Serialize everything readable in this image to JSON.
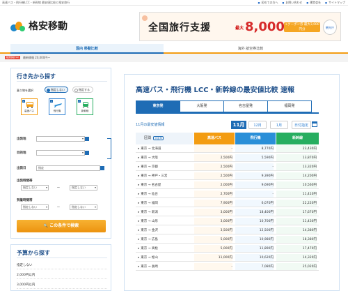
{
  "topbar": {
    "left": "高速バス・飛行機LCC・新幹線 最安値比較と格安旅行",
    "links": [
      "初めての方へ",
      "お問い合わせ",
      "運営会社",
      "サイトマップ"
    ]
  },
  "logo": {
    "text": "格安移動"
  },
  "banner": {
    "title": "全国旅行支援",
    "max_label": "最大",
    "amount": "8,000",
    "unit": "円割",
    "coupon": "+クーポン券 最大3,000円分",
    "badge": "観光庁"
  },
  "nav": {
    "tabs": [
      "国内 移動比較",
      "海外 航空券比較"
    ]
  },
  "breadcrumb": {
    "home": "格安移動TOP",
    "text": "最新情報   20,000円〜"
  },
  "sidebar": {
    "title": "行き先から探す",
    "trip_type_label": "乗り物を選択",
    "radio_specify_none": "指定しない",
    "radio_specify": "指定する",
    "modes": [
      "高速バス",
      "飛行機",
      "新幹線"
    ],
    "from_label": "出発地",
    "to_label": "目的地",
    "date_label": "出発日",
    "date_value": "指定",
    "dep_time_label": "出発時間帯",
    "arr_time_label": "到着時間帯",
    "select_default": "指定しない",
    "tilde": "〜",
    "search_button": "この条件で検索"
  },
  "budget": {
    "title": "予算から探す",
    "rows": [
      "指定しない",
      "2,000円以内",
      "3,000円以内"
    ]
  },
  "main": {
    "title": "高速バス・飛行機 LCC・新幹線の最安値比較 速報",
    "city_tabs": [
      "東京発",
      "大阪発",
      "名古屋発",
      "福岡発"
    ],
    "month_label": "11月の最安値情報",
    "months": [
      "11月",
      "12月",
      "1月",
      "日付指定"
    ],
    "headers": {
      "route": "区間",
      "route_tag": "片道 ▼",
      "bus": "高速バス",
      "plane": "飛行機",
      "train": "新幹線"
    },
    "rows": [
      {
        "route": "東京 → 北海道",
        "bus": "-",
        "plane": "8,770円",
        "train": "23,430円"
      },
      {
        "route": "東京 → 大阪",
        "bus": "2,500円",
        "plane": "5,590円",
        "train": "13,870円"
      },
      {
        "route": "東京 → 京都",
        "bus": "2,500円",
        "plane": "-",
        "train": "13,320円"
      },
      {
        "route": "東京 → 神戸・三宮",
        "bus": "2,500円",
        "plane": "9,390円",
        "train": "14,200円"
      },
      {
        "route": "東京 → 名古屋",
        "bus": "2,000円",
        "plane": "9,690円",
        "train": "10,560円"
      },
      {
        "route": "東京 → 仙台",
        "bus": "2,700円",
        "plane": "-",
        "train": "11,410円"
      },
      {
        "route": "東京 → 福岡",
        "bus": "7,900円",
        "plane": "6,070円",
        "train": "22,220円"
      },
      {
        "route": "東京 → 新潟",
        "bus": "3,000円",
        "plane": "18,400円",
        "train": "17,670円"
      },
      {
        "route": "東京 → 山形",
        "bus": "3,000円",
        "plane": "10,700円",
        "train": "11,430円"
      },
      {
        "route": "東京 → 金沢",
        "bus": "3,500円",
        "plane": "12,500円",
        "train": "14,380円"
      },
      {
        "route": "東京 → 広島",
        "bus": "5,000円",
        "plane": "10,980円",
        "train": "18,380円"
      },
      {
        "route": "東京 → 高松",
        "bus": "5,000円",
        "plane": "11,890円",
        "train": "17,470円"
      },
      {
        "route": "東京 → 松山",
        "bus": "11,000円",
        "plane": "10,620円",
        "train": "14,320円"
      },
      {
        "route": "東京 → 長崎",
        "bus": "-",
        "plane": "7,080円",
        "train": "25,020円"
      }
    ]
  },
  "colors": {
    "accent": "#1e6cb5",
    "bus": "#f39c12",
    "plane": "#2a8fd8",
    "train": "#27ae60"
  }
}
